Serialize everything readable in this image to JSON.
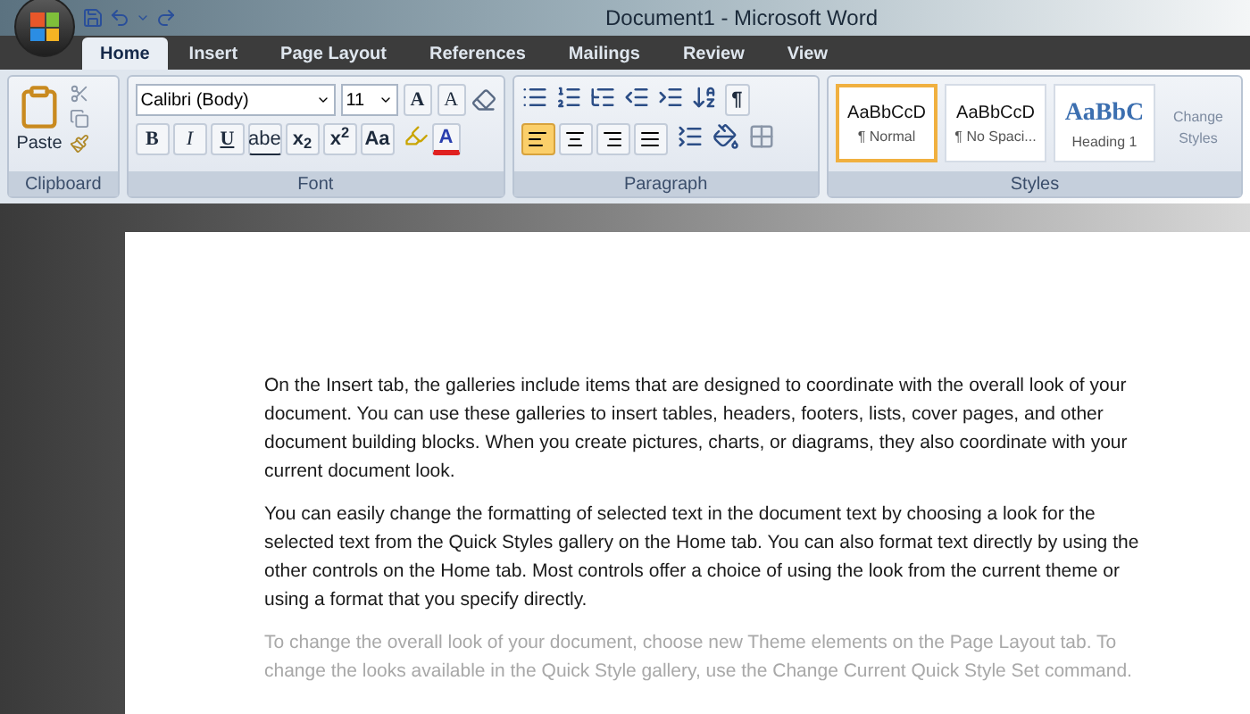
{
  "window": {
    "title": "Document1 - Microsoft Word"
  },
  "tabs": [
    {
      "label": "Home",
      "selected": true
    },
    {
      "label": "Insert",
      "selected": false
    },
    {
      "label": "Page Layout",
      "selected": false
    },
    {
      "label": "References",
      "selected": false
    },
    {
      "label": "Mailings",
      "selected": false
    },
    {
      "label": "Review",
      "selected": false
    },
    {
      "label": "View",
      "selected": false
    }
  ],
  "ribbon": {
    "clipboard": {
      "label": "Clipboard",
      "paste": "Paste"
    },
    "font": {
      "label": "Font",
      "family": "Calibri (Body)",
      "size": "11",
      "grow": "A",
      "shrink": "A",
      "color_button": "A",
      "format_buttons": [
        {
          "kind": "bold",
          "label": "B"
        },
        {
          "kind": "italic",
          "label": "I"
        },
        {
          "kind": "underline",
          "label": "U"
        },
        {
          "kind": "strike",
          "label": "abe"
        },
        {
          "kind": "script",
          "label": "x$_{2}$"
        },
        {
          "kind": "script",
          "label": "x$^{2}$"
        },
        {
          "kind": "case",
          "label": "Aa"
        }
      ]
    },
    "paragraph": {
      "label": "Paragraph",
      "pilcrow": "¶",
      "alignments": [
        {
          "selected": true
        },
        {
          "selected": false
        },
        {
          "selected": false
        },
        {
          "selected": false
        }
      ]
    },
    "styles": {
      "label": "Styles",
      "change_styles": "Change Styles",
      "items": [
        {
          "kind": "body",
          "sample": "AaBbCcD",
          "name": "¶ Normal",
          "selected": true
        },
        {
          "kind": "body",
          "sample": "AaBbCcD",
          "name": "¶ No Spaci...",
          "selected": false
        },
        {
          "kind": "heading",
          "sample": "AaBbC",
          "name": "Heading 1",
          "selected": false
        }
      ]
    }
  },
  "document": {
    "paragraphs": [
      {
        "text": "On the Insert tab, the galleries include items that are designed to coordinate with the overall look of your document. You can use these galleries to insert tables, headers, footers, lists, cover pages, and other document building blocks. When you create pictures, charts, or diagrams, they also coordinate with your current document look.",
        "faded": false
      },
      {
        "text": "You can easily change the formatting of selected text in the document text by choosing a look for the selected text from the Quick Styles gallery on the Home tab. You can also format text directly by using the other controls on the Home tab. Most controls offer a choice of using the look from the current theme or using a format that you specify directly.",
        "faded": false
      },
      {
        "text": "To change the overall look of your document, choose new Theme elements on the Page Layout tab. To change the looks available in the Quick Style gallery, use the Change Current Quick Style Set command.",
        "faded": true
      }
    ]
  }
}
